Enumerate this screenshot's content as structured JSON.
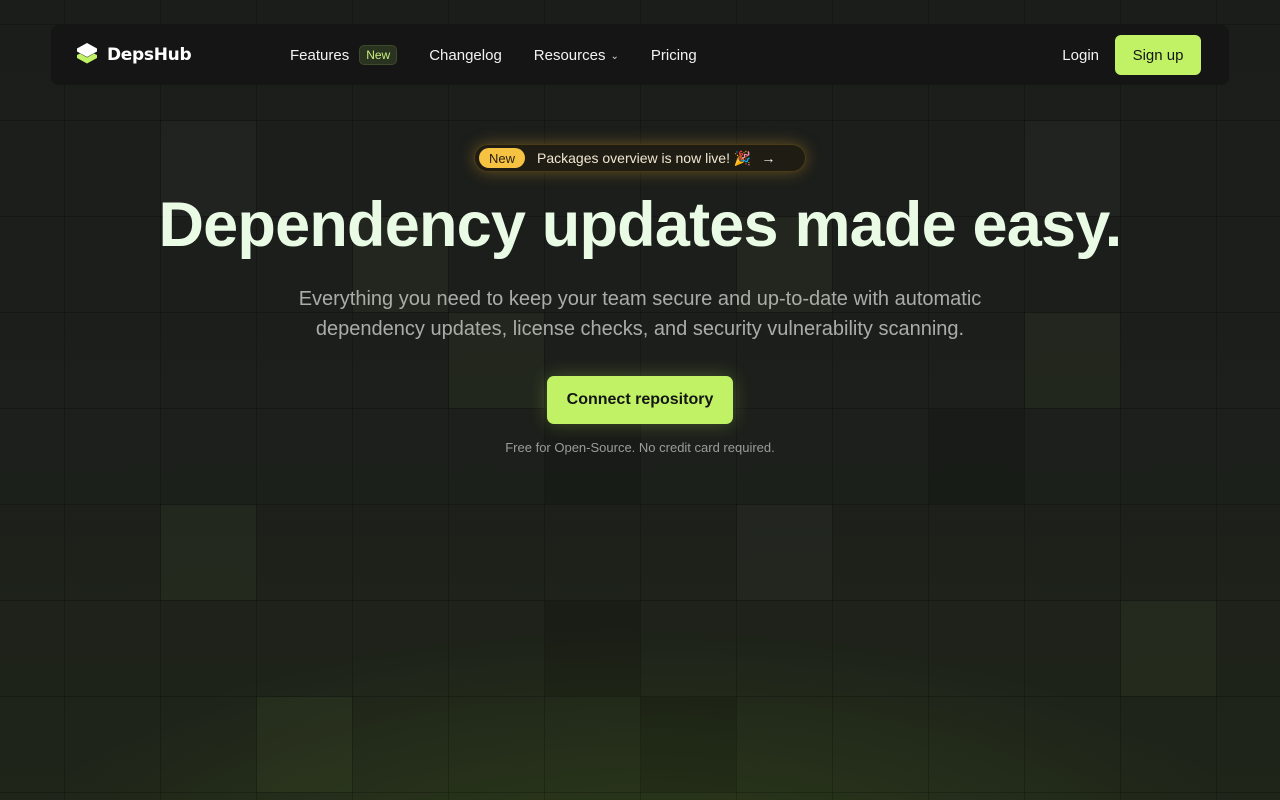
{
  "brand": {
    "name": "DepsHub",
    "accent_color": "#c1f266",
    "announcement_color": "#f5c242"
  },
  "nav": {
    "items": [
      {
        "label": "Features",
        "badge": "New"
      },
      {
        "label": "Changelog"
      },
      {
        "label": "Resources",
        "icon": "chevron-down-icon"
      },
      {
        "label": "Pricing"
      }
    ],
    "login_label": "Login",
    "signup_label": "Sign up"
  },
  "announcement": {
    "badge": "New",
    "text": "Packages overview is now live! 🎉",
    "icon": "arrow-right-icon"
  },
  "hero": {
    "title": "Dependency updates made easy.",
    "subtitle": "Everything you need to keep your team secure and up-to-date with automatic dependency updates, license checks, and security vulnerability scanning.",
    "cta_label": "Connect repository",
    "note": "Free for Open-Source. No credit card required."
  }
}
